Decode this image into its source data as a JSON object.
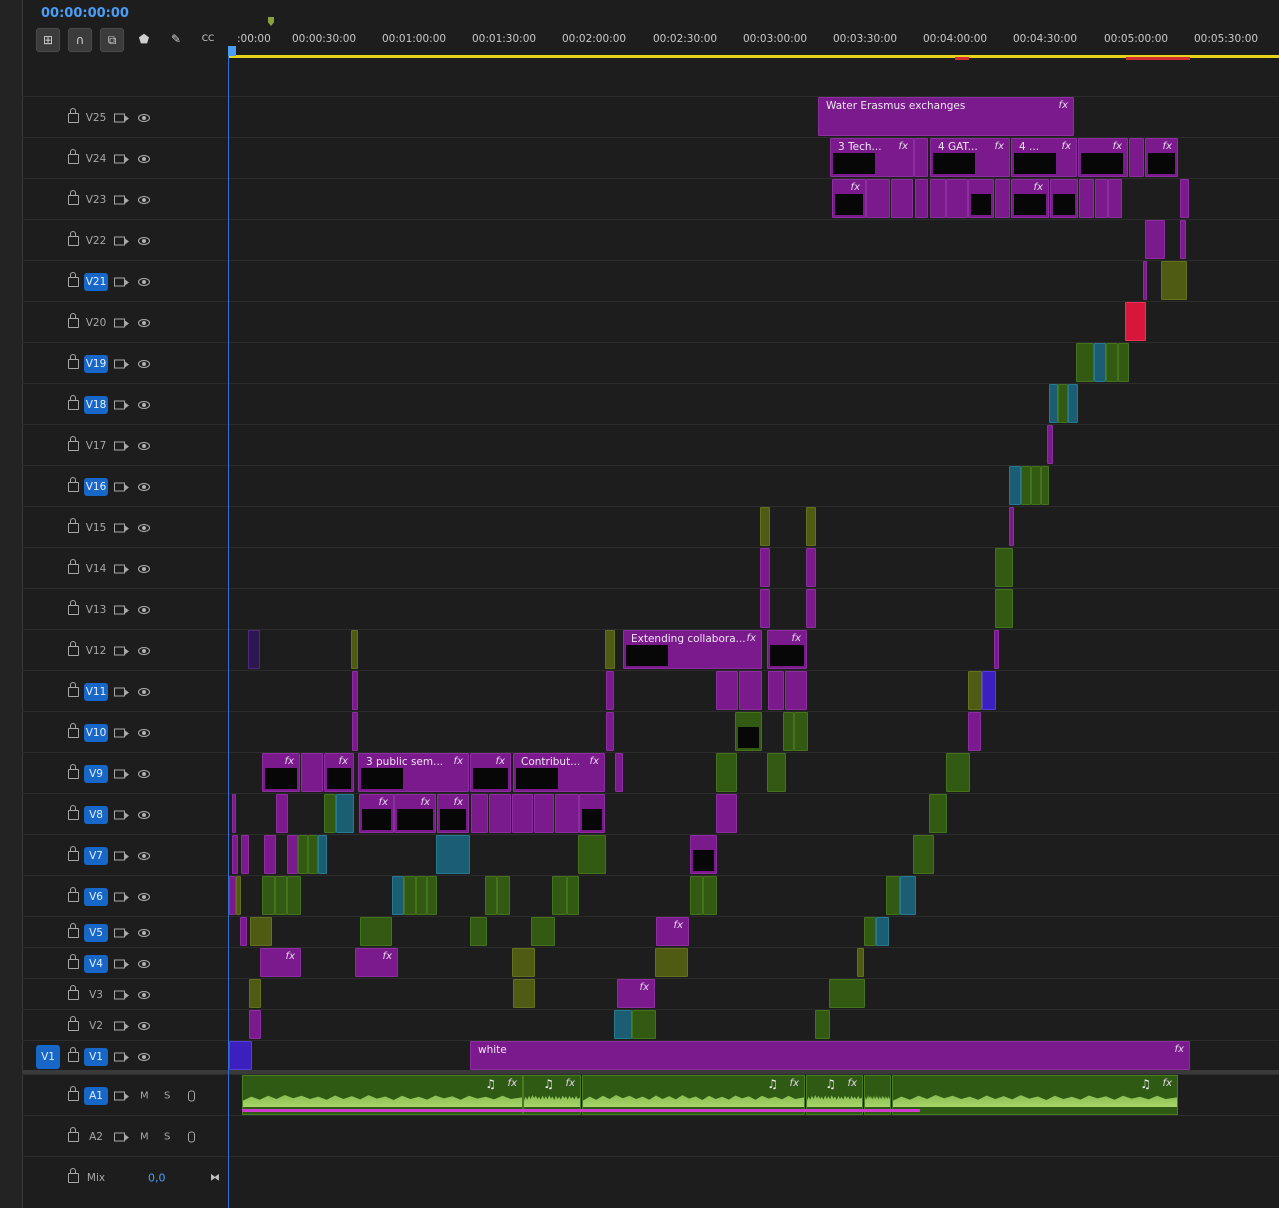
{
  "timecode": "00:00:00:00",
  "ruler": {
    "ticks": [
      ":00:00",
      "00:00:30:00",
      "00:01:00:00",
      "00:01:30:00",
      "00:02:00:00",
      "00:02:30:00",
      "00:03:00:00",
      "00:03:30:00",
      "00:04:00:00",
      "00:04:30:00",
      "00:05:00:00",
      "00:05:30:00"
    ]
  },
  "tools": [
    "insert-sequence-icon",
    "snap-icon",
    "linked-selection-icon",
    "add-marker-icon",
    "settings-wrench-icon",
    "captions-icon"
  ],
  "video_tracks": [
    {
      "label": "V25",
      "target": false
    },
    {
      "label": "V24",
      "target": false
    },
    {
      "label": "V23",
      "target": false
    },
    {
      "label": "V22",
      "target": false
    },
    {
      "label": "V21",
      "target": true
    },
    {
      "label": "V20",
      "target": false
    },
    {
      "label": "V19",
      "target": true
    },
    {
      "label": "V18",
      "target": true
    },
    {
      "label": "V17",
      "target": false
    },
    {
      "label": "V16",
      "target": true
    },
    {
      "label": "V15",
      "target": false
    },
    {
      "label": "V14",
      "target": false
    },
    {
      "label": "V13",
      "target": false
    },
    {
      "label": "V12",
      "target": false
    },
    {
      "label": "V11",
      "target": true
    },
    {
      "label": "V10",
      "target": true
    },
    {
      "label": "V9",
      "target": true
    },
    {
      "label": "V8",
      "target": true
    },
    {
      "label": "V7",
      "target": true
    },
    {
      "label": "V6",
      "target": true
    },
    {
      "label": "V5",
      "target": true
    },
    {
      "label": "V4",
      "target": true
    },
    {
      "label": "V3",
      "target": false
    },
    {
      "label": "V2",
      "target": false
    },
    {
      "label": "V1",
      "target": true
    }
  ],
  "v1_source_label": "V1",
  "audio_tracks": [
    {
      "label": "A1",
      "target": true,
      "m": "M",
      "s": "S"
    },
    {
      "label": "A2",
      "target": false,
      "m": "M",
      "s": "S"
    }
  ],
  "mix": {
    "label": "Mix",
    "value": "0,0"
  },
  "clip_titles": {
    "water": "Water Erasmus exchanges",
    "tech": "3 Tech...",
    "gat": "4 GAT...",
    "four": "4 ...",
    "extending": "Extending collabora...",
    "public": "3 public sem...",
    "contrib": "Contribut...",
    "white": "white"
  },
  "fx_label": "fx",
  "note_glyph": "♫",
  "colors": {
    "purple": "#7a1a8c",
    "green": "#325a12",
    "olive": "#4f5a12",
    "teal": "#1b5d72",
    "red": "#d8163c",
    "blue": "#3b1fbf",
    "timecode": "#4a9ef5",
    "ruler_work_area": "#e8d21c"
  }
}
